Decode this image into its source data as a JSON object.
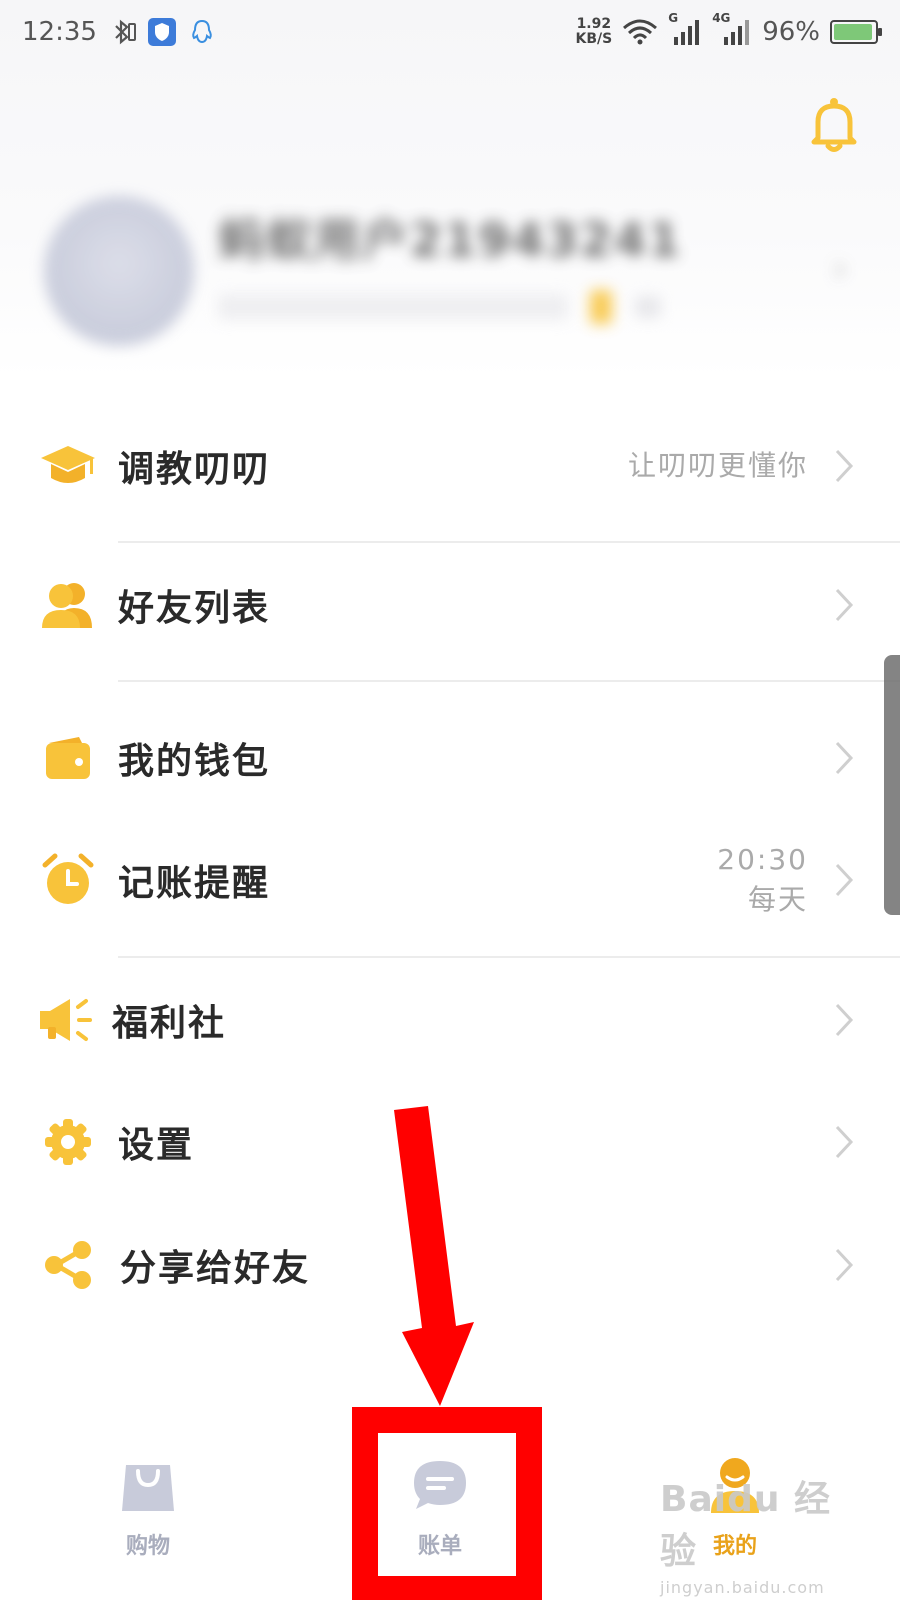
{
  "status_bar": {
    "time": "12:35",
    "net_speed_value": "1.92",
    "net_speed_unit": "KB/S",
    "signal_1_label": "G",
    "signal_2_label": "4G",
    "battery": "96%",
    "battery_level": 0.96
  },
  "profile": {
    "name": "蚂蚁用户21943241",
    "subtitle": "",
    "blurred": true
  },
  "menu": {
    "items": [
      {
        "label": "调教叨叨",
        "right_text": "让叨叨更懂你",
        "icon": "graduation-cap-icon"
      },
      {
        "label": "好友列表",
        "right_text": "",
        "icon": "friends-icon"
      },
      {
        "label": "我的钱包",
        "right_text": "",
        "icon": "wallet-icon"
      },
      {
        "label": "记账提醒",
        "right_time": "20:30",
        "right_freq": "每天",
        "icon": "alarm-clock-icon"
      },
      {
        "label": "福利社",
        "right_text": "",
        "icon": "megaphone-icon"
      },
      {
        "label": "设置",
        "right_text": "",
        "icon": "gear-icon"
      },
      {
        "label": "分享给好友",
        "right_text": "",
        "icon": "share-icon"
      }
    ]
  },
  "tabbar": {
    "tabs": [
      {
        "label": "购物",
        "icon": "shopping-bag-icon",
        "active": false
      },
      {
        "label": "账单",
        "icon": "chat-bubble-icon",
        "active": false
      },
      {
        "label": "我的",
        "icon": "user-icon",
        "active": true
      }
    ]
  },
  "annotation": {
    "color": "#ff0000",
    "target": "账单"
  },
  "watermark": {
    "brand": "Baidu 经验",
    "url": "jingyan.baidu.com"
  },
  "colors": {
    "accent": "#f8c33a",
    "accent_dark": "#f0a81e",
    "inactive_tab": "#c8cbda",
    "highlight": "#ff0000"
  }
}
